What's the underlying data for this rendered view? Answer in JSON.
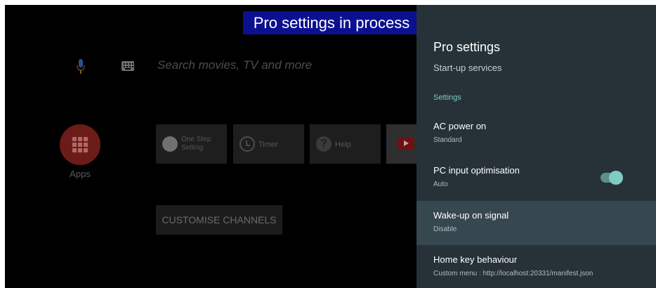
{
  "banner": {
    "text": "Pro settings in process"
  },
  "home": {
    "search_placeholder": "Search movies, TV and more",
    "apps_label": "Apps",
    "tiles": [
      {
        "label": "One Step Setting",
        "icon": "wrench-icon"
      },
      {
        "label": "Timer",
        "icon": "timer-icon"
      },
      {
        "label": "Help",
        "icon": "help-icon"
      }
    ],
    "youtube_icon": "youtube-icon",
    "customise_button": "CUSTOMISE CHANNELS"
  },
  "panel": {
    "title": "Pro settings",
    "peek_item": "Start-up services",
    "section_header": "Settings",
    "items": [
      {
        "title": "AC power on",
        "subtitle": "Standard"
      },
      {
        "title": "PC input optimisation",
        "subtitle": "Auto",
        "toggle": true
      },
      {
        "title": "Wake-up on signal",
        "subtitle": "Disable",
        "focused": true
      },
      {
        "title": "Home key behaviour",
        "subtitle": "Custom menu : http://localhost:20331/manifest.json"
      }
    ]
  },
  "colors": {
    "panel_bg": "#263238",
    "focused_row": "#37474f",
    "accent_teal": "#80cbc4",
    "banner_bg": "#0b1090"
  }
}
